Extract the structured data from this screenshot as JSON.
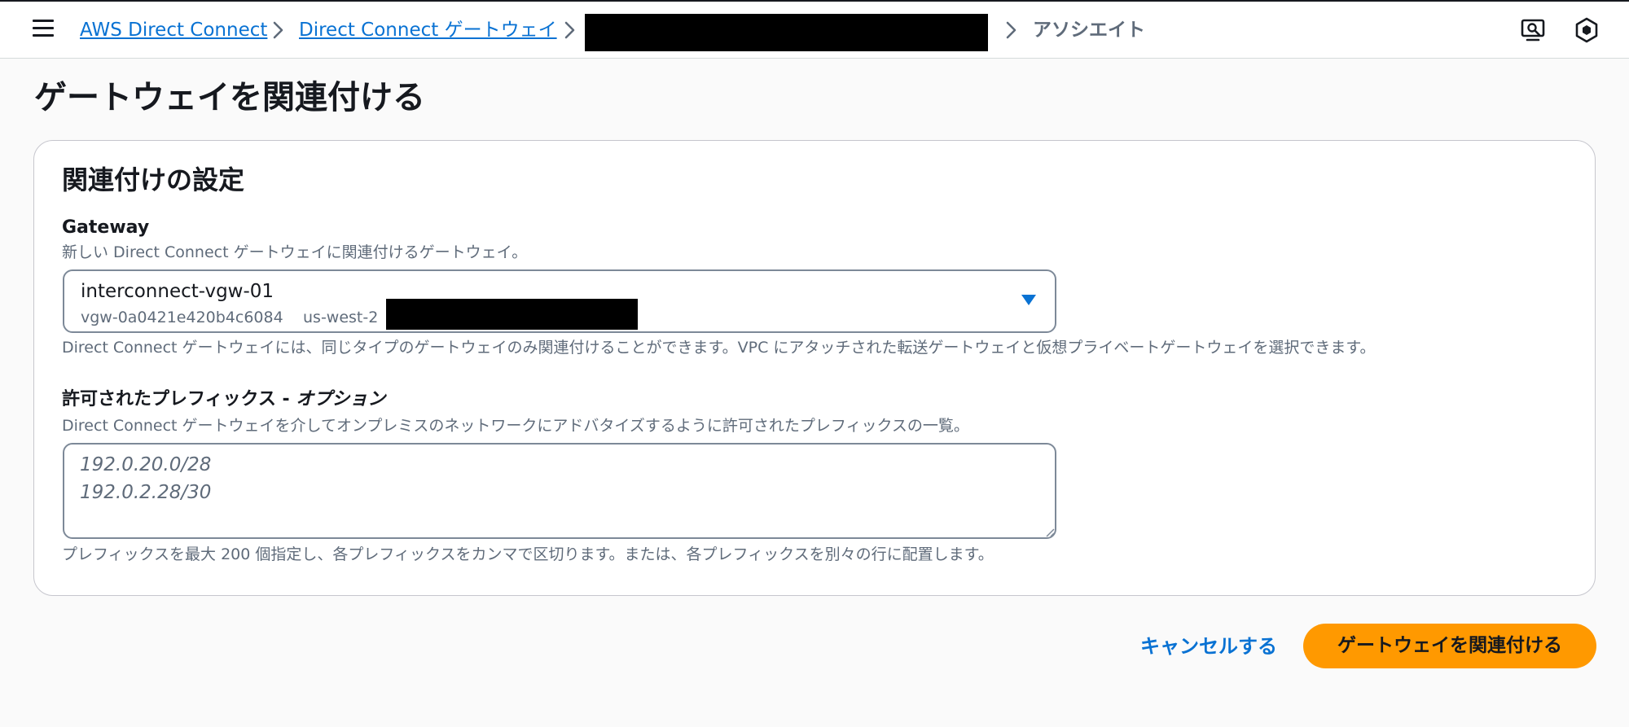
{
  "breadcrumb": {
    "items": [
      "AWS Direct Connect",
      "Direct Connect ゲートウェイ"
    ],
    "current": "アソシエイト"
  },
  "page": {
    "title": "ゲートウェイを関連付ける"
  },
  "panel": {
    "title": "関連付けの設定",
    "gateway": {
      "label": "Gateway",
      "description": "新しい Direct Connect ゲートウェイに関連付けるゲートウェイ。",
      "selected_name": "interconnect-vgw-01",
      "selected_id": "vgw-0a0421e420b4c6084",
      "selected_region": "us-west-2",
      "constraint": "Direct Connect ゲートウェイには、同じタイプのゲートウェイのみ関連付けることができます。VPC にアタッチされた転送ゲートウェイと仮想プライベートゲートウェイを選択できます。"
    },
    "prefixes": {
      "label": "許可されたプレフィックス - ",
      "label_optional": "オプション",
      "description": "Direct Connect ゲートウェイを介してオンプレミスのネットワークにアドバタイズするように許可されたプレフィックスの一覧。",
      "placeholder_line1": "192.0.20.0/28",
      "placeholder_line2": "192.0.2.28/30",
      "constraint": "プレフィックスを最大 200 個指定し、各プレフィックスをカンマで区切ります。または、各プレフィックスを別々の行に配置します。"
    }
  },
  "actions": {
    "cancel_label": "キャンセルする",
    "submit_label": "ゲートウェイを関連付ける"
  },
  "colors": {
    "link": "#0972d3",
    "primary_button": "#ff9900",
    "text": "#16191f",
    "secondary_text": "#5f6b7a"
  },
  "icons": [
    "menu-icon",
    "chevron-right-icon",
    "feedback-icon",
    "settings-hex-icon",
    "caret-down-icon",
    "resize-grip-icon"
  ]
}
